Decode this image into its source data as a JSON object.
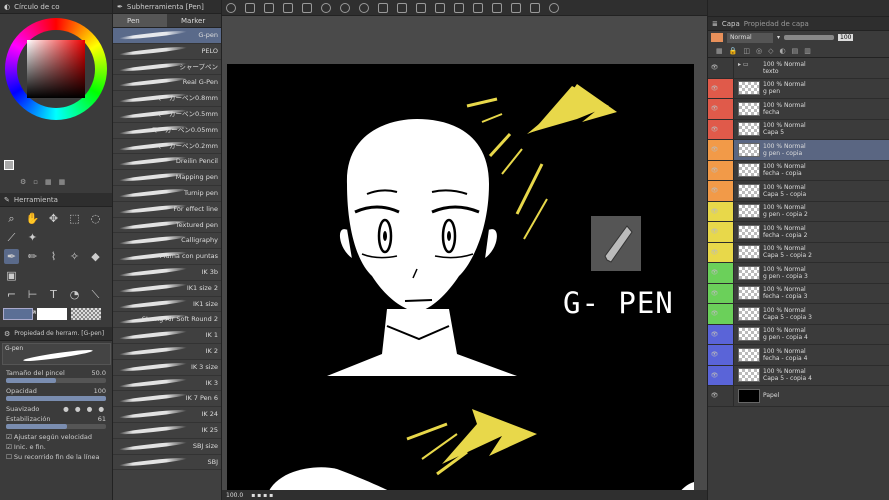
{
  "left_panel": {
    "color_title": "Círculo de co",
    "tool_title": "Herramienta",
    "property_title": "Propiedad de herram. [G-pen]",
    "brush_name": "G-pen",
    "brush_size_label": "Tamaño del pincel",
    "brush_size_value": "50.0",
    "opacity_label": "Opacidad",
    "opacity_value": "100",
    "smoothing_label": "Suavizado",
    "stabilization_label": "Estabilización",
    "stabilization_value": "61",
    "adjust_speed_label": "Ajustar según velocidad",
    "start_end_label": "Inic. e fin.",
    "bottom_label": "Su recorrido fin de la línea"
  },
  "sub_tool": {
    "title": "Subherramienta [Pen]",
    "tabs": [
      "Pen",
      "Marker"
    ],
    "brushes": [
      "G-pen",
      "PELO",
      "シャープペン",
      "Real G-Pen",
      "マーカーペン0.8mm",
      "マーカーペン0.5mm",
      "マーカーペン0.05mm",
      "マーカーペン0.2mm",
      "Dreilin Pencil",
      "Mapping pen",
      "Turnip pen",
      "For effect line",
      "Textured pen",
      "Calligraphy",
      "Pluma con puntas",
      "IK 3b",
      "IK1 size 2",
      "IK1 size",
      "Strong Air Soft Round 2",
      "IK 1",
      "IK 2",
      "IK 3 size",
      "IK 3",
      "IK 7 Pen 6",
      "IK 24",
      "IK 25",
      "SBJ size",
      "SBJ"
    ]
  },
  "canvas": {
    "label": "G- PEN",
    "zoom": "100.0"
  },
  "layers_panel": {
    "tab_layer": "Capa",
    "tab_other": "Propiedad de capa",
    "blend_mode": "Normal",
    "opacity": "100",
    "layers": [
      {
        "line1": "100 % Normal",
        "line2": "texto",
        "color": "#3a3a3a",
        "folder": true
      },
      {
        "line1": "100 % Normal",
        "line2": "g pen",
        "color": "#e05a4a"
      },
      {
        "line1": "100 % Normal",
        "line2": "fecha",
        "color": "#e05a4a"
      },
      {
        "line1": "100 % Normal",
        "line2": "Capa 5",
        "color": "#e05a4a"
      },
      {
        "line1": "100 % Normal",
        "line2": "g pen - copia",
        "color": "#f29a48"
      },
      {
        "line1": "100 % Normal",
        "line2": "fecha - copia",
        "color": "#f29a48"
      },
      {
        "line1": "100 % Normal",
        "line2": "Capa 5 - copia",
        "color": "#f29a48"
      },
      {
        "line1": "100 % Normal",
        "line2": "g pen - copia 2",
        "color": "#e8d84a"
      },
      {
        "line1": "100 % Normal",
        "line2": "fecha - copia 2",
        "color": "#e8d84a"
      },
      {
        "line1": "100 % Normal",
        "line2": "Capa 5 - copia 2",
        "color": "#e8d84a"
      },
      {
        "line1": "100 % Normal",
        "line2": "g pen - copia 3",
        "color": "#6bd05a"
      },
      {
        "line1": "100 % Normal",
        "line2": "fecha - copia 3",
        "color": "#6bd05a"
      },
      {
        "line1": "100 % Normal",
        "line2": "Capa 5 - copia 3",
        "color": "#6bd05a"
      },
      {
        "line1": "100 % Normal",
        "line2": "g pen - copia 4",
        "color": "#5a64d8"
      },
      {
        "line1": "100 % Normal",
        "line2": "fecha - copia 4",
        "color": "#5a64d8"
      },
      {
        "line1": "100 % Normal",
        "line2": "Capa 5 - copia 4",
        "color": "#5a64d8"
      },
      {
        "line1": "",
        "line2": "Papel",
        "color": "#3a3a3a",
        "paper": true
      }
    ]
  }
}
